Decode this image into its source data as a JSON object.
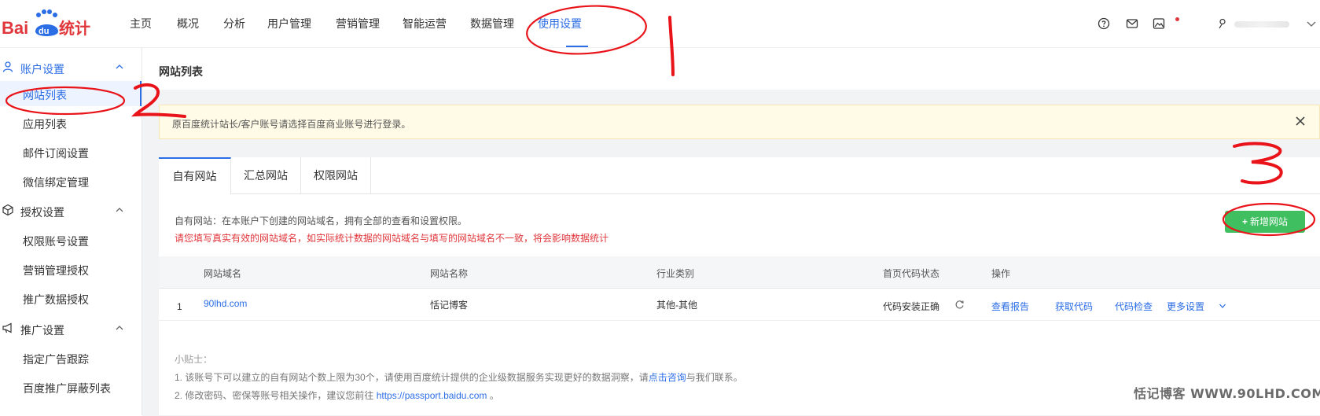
{
  "brand": {
    "logo_text": "Bai du 统计"
  },
  "topnav": {
    "items": [
      {
        "label": "主页"
      },
      {
        "label": "概况"
      },
      {
        "label": "分析"
      },
      {
        "label": "用户管理"
      },
      {
        "label": "营销管理"
      },
      {
        "label": "智能运营"
      },
      {
        "label": "数据管理"
      },
      {
        "label": "使用设置",
        "active": true
      }
    ],
    "icons": [
      "help-icon",
      "message-icon",
      "image-icon",
      "user-icon"
    ]
  },
  "sidebar": {
    "groups": [
      {
        "label": "账户设置",
        "icon": "user-icon",
        "expanded": true,
        "active": true,
        "items": [
          {
            "label": "网站列表",
            "active": true
          },
          {
            "label": "应用列表"
          },
          {
            "label": "邮件订阅设置"
          },
          {
            "label": "微信绑定管理"
          }
        ]
      },
      {
        "label": "授权设置",
        "icon": "cube-icon",
        "expanded": true,
        "items": [
          {
            "label": "权限账号设置"
          },
          {
            "label": "营销管理授权"
          },
          {
            "label": "推广数据授权"
          }
        ]
      },
      {
        "label": "推广设置",
        "icon": "megaphone-icon",
        "expanded": true,
        "items": [
          {
            "label": "指定广告跟踪"
          },
          {
            "label": "百度推广屏蔽列表"
          }
        ]
      }
    ]
  },
  "page": {
    "title": "网站列表",
    "notice": "原百度统计站长/客户账号请选择百度商业账号进行登录。",
    "tabs": [
      {
        "label": "自有网站",
        "active": true
      },
      {
        "label": "汇总网站"
      },
      {
        "label": "权限网站"
      }
    ],
    "description": "自有网站：在本账户下创建的网站域名，拥有全部的查看和设置权限。",
    "warning": "请您填写真实有效的网站域名，如实际统计数据的网站域名与填写的网站域名不一致，将会影响数据统计",
    "add_button": "新增网站",
    "table": {
      "columns": [
        "网站域名",
        "网站名称",
        "行业类别",
        "首页代码状态",
        "操作"
      ],
      "rows": [
        {
          "index": "1",
          "domain": "90lhd.com",
          "name": "恬记博客",
          "industry": "其他-其他",
          "code_status": "代码安装正确",
          "actions": [
            "查看报告",
            "获取代码",
            "代码检查",
            "更多设置"
          ]
        }
      ]
    },
    "tips": {
      "title": "小贴士：",
      "tip1_prefix": "1. 该账号下可以建立的自有网站个数上限为30个，请使用百度统计提供的企业级数据服务实现更好的数据洞察，请",
      "tip1_link": "点击咨询",
      "tip1_suffix": "与我们联系。",
      "tip2_prefix": "2. 修改密码、密保等账号相关操作，建议您前往 ",
      "tip2_link": "https://passport.baidu.com",
      "tip2_suffix": " 。"
    }
  },
  "watermark": "恬记博客 WWW.90LHD.COM",
  "annotations": [
    "1",
    "2",
    "3"
  ],
  "colors": {
    "accent": "#2b6de5",
    "success": "#3fbf5f",
    "danger": "#e0373c",
    "notice_bg": "#fffbe6",
    "annotation": "#e8141a"
  }
}
